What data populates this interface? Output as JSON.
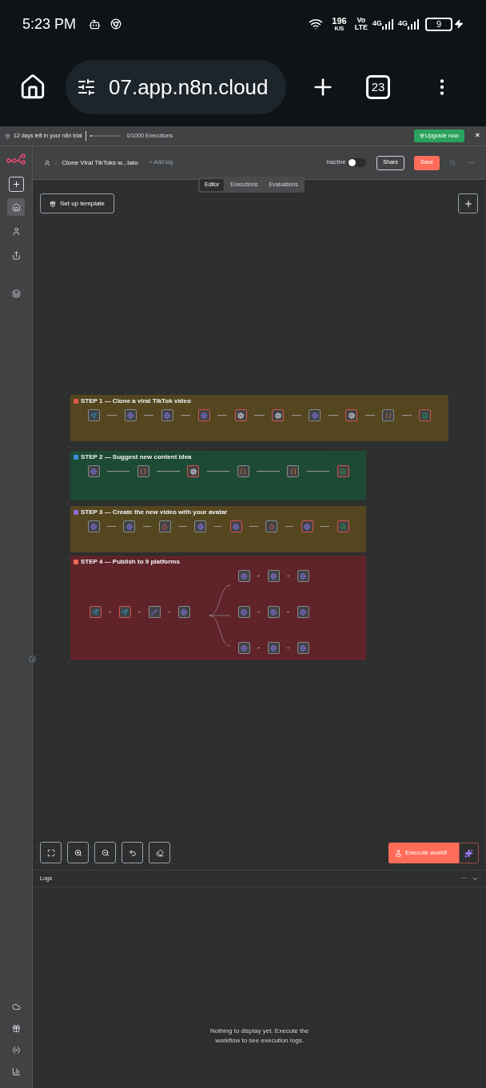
{
  "status_bar": {
    "time": "5:23 PM",
    "speed": "196",
    "speed_unit": "K/S",
    "volte_top": "Vo",
    "volte_bottom": "LTE",
    "net_1": "4G",
    "net_2": "4G",
    "battery": "9"
  },
  "browser": {
    "url": "07.app.n8n.cloud",
    "tab_count": "23"
  },
  "trial_banner": {
    "text": "12 days left in your n8n trial",
    "level": 0.02,
    "executions": "0/1000 Executions",
    "upgrade": "Upgrade now",
    "close": "×"
  },
  "sidebar": {
    "items": [
      {
        "kind": "home",
        "selected": true
      },
      {
        "kind": "person",
        "selected": false
      },
      {
        "kind": "share",
        "selected": false
      },
      {
        "kind": "layers",
        "selected": false
      }
    ],
    "bottom": [
      {
        "kind": "cloud"
      },
      {
        "kind": "gift"
      },
      {
        "kind": "variable"
      },
      {
        "kind": "chart"
      }
    ]
  },
  "header": {
    "separator": "/",
    "title": "Clone Viral TikToks w...tato",
    "add_tag": "+ Add tag",
    "status": "Inactive",
    "active": false,
    "share": "Share",
    "save": "Save",
    "more": "···"
  },
  "tabs": [
    {
      "label": "Editor",
      "selected": true
    },
    {
      "label": "Executions",
      "selected": false
    },
    {
      "label": "Evaluations",
      "selected": false
    }
  ],
  "canvas": {
    "template_button": "Set up template",
    "execute_button": "Execute workfl",
    "steps": [
      {
        "title": "STEP 1 — Clone a viral TikTok video",
        "color": "#e05a4a",
        "nodes": [
          {
            "kind": "telegram",
            "warning": false
          },
          {
            "kind": "http",
            "warning": false
          },
          {
            "kind": "http",
            "warning": false
          },
          {
            "kind": "http",
            "warning": true
          },
          {
            "kind": "openai",
            "warning": true
          },
          {
            "kind": "openai",
            "warning": true
          },
          {
            "kind": "http",
            "warning": false
          },
          {
            "kind": "openai",
            "warning": true
          },
          {
            "kind": "code",
            "warning": false
          },
          {
            "kind": "sheets",
            "warning": true
          }
        ]
      },
      {
        "title": "STEP 2 — Suggest new content idea",
        "color": "#3b8fd9",
        "nodes": [
          {
            "kind": "http",
            "warning": false
          },
          {
            "kind": "code",
            "warning": false
          },
          {
            "kind": "openai",
            "warning": true
          },
          {
            "kind": "code",
            "warning": false
          },
          {
            "kind": "code",
            "warning": false
          },
          {
            "kind": "sheets",
            "warning": true
          }
        ]
      },
      {
        "title": "STEP 3 — Create the new video with your avatar",
        "color": "#8a6ad8",
        "nodes": [
          {
            "kind": "http",
            "warning": false
          },
          {
            "kind": "http",
            "warning": false
          },
          {
            "kind": "wait",
            "warning": false
          },
          {
            "kind": "http",
            "warning": false
          },
          {
            "kind": "http",
            "warning": true
          },
          {
            "kind": "wait",
            "warning": false
          },
          {
            "kind": "http",
            "warning": true
          },
          {
            "kind": "sheets",
            "warning": true
          }
        ]
      },
      {
        "title": "STEP 4 — Publish to 9 platforms",
        "color": "#f06a5a",
        "nodes": [
          {
            "kind": "telegram",
            "warning": true
          },
          {
            "kind": "telegram",
            "warning": true
          },
          {
            "kind": "edit",
            "warning": false
          },
          {
            "kind": "http",
            "warning": false
          }
        ],
        "platforms": [
          {
            "kind": "http"
          },
          {
            "kind": "http"
          },
          {
            "kind": "http"
          },
          {
            "kind": "http"
          },
          {
            "kind": "http"
          },
          {
            "kind": "http"
          },
          {
            "kind": "http"
          },
          {
            "kind": "http"
          },
          {
            "kind": "http"
          }
        ]
      }
    ]
  },
  "logs": {
    "title": "Logs",
    "more": "···",
    "empty": "Nothing to display yet. Execute the workflow to see execution logs."
  }
}
